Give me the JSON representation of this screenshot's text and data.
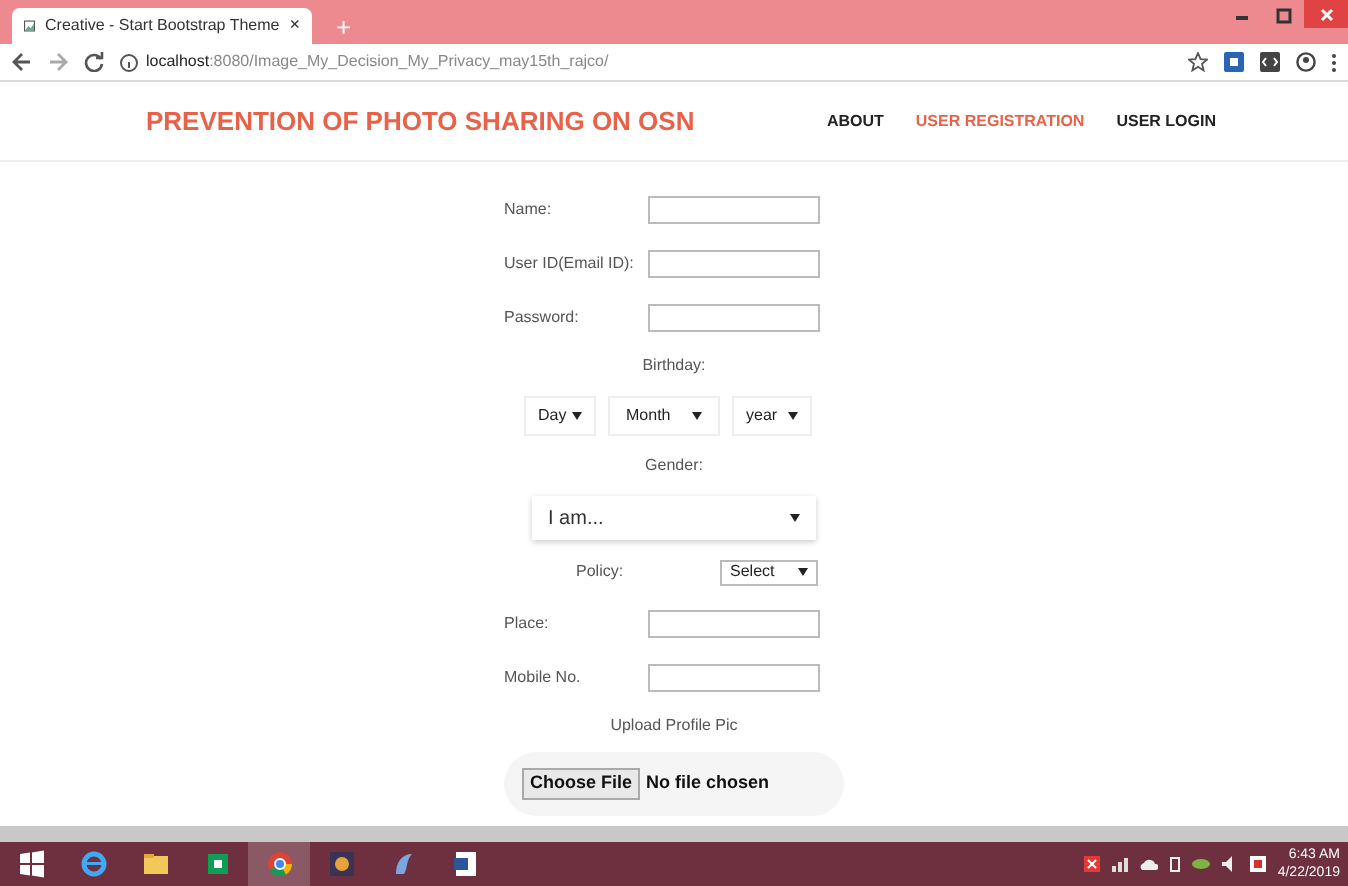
{
  "browser": {
    "tabs": [
      {
        "title": "Creative - Start Bootstrap Theme",
        "close": "×",
        "selected": true
      }
    ],
    "new_tab": "+",
    "url_host": "localhost",
    "url_path": ":8080/Image_My_Decision_My_Privacy_may15th_rajco/"
  },
  "navbar": {
    "brand": "PREVENTION OF PHOTO SHARING ON OSN",
    "links": [
      {
        "label": "ABOUT",
        "selected": false
      },
      {
        "label": "USER REGISTRATION",
        "selected": true
      },
      {
        "label": "USER LOGIN",
        "selected": false
      }
    ]
  },
  "form": [
    {
      "kind": "text",
      "label": "Name:"
    },
    {
      "kind": "text",
      "label": "User ID(Email ID):"
    },
    {
      "kind": "text",
      "label": "Password:"
    },
    {
      "kind": "heading",
      "label": "Birthday:"
    },
    {
      "kind": "selects",
      "options": [
        "Day",
        "Month",
        "year"
      ]
    },
    {
      "kind": "heading",
      "label": "Gender:"
    },
    {
      "kind": "wide-select",
      "value": "I am..."
    },
    {
      "kind": "select",
      "label": "Policy:",
      "value": "Select"
    },
    {
      "kind": "text",
      "label": "Place:"
    },
    {
      "kind": "text",
      "label": "Mobile No."
    },
    {
      "kind": "heading",
      "label": "Upload Profile Pic"
    },
    {
      "kind": "file",
      "button": "Choose File",
      "status": "No file chosen"
    }
  ],
  "taskbar": {
    "time": "6:43 AM",
    "date": "4/22/2019"
  }
}
